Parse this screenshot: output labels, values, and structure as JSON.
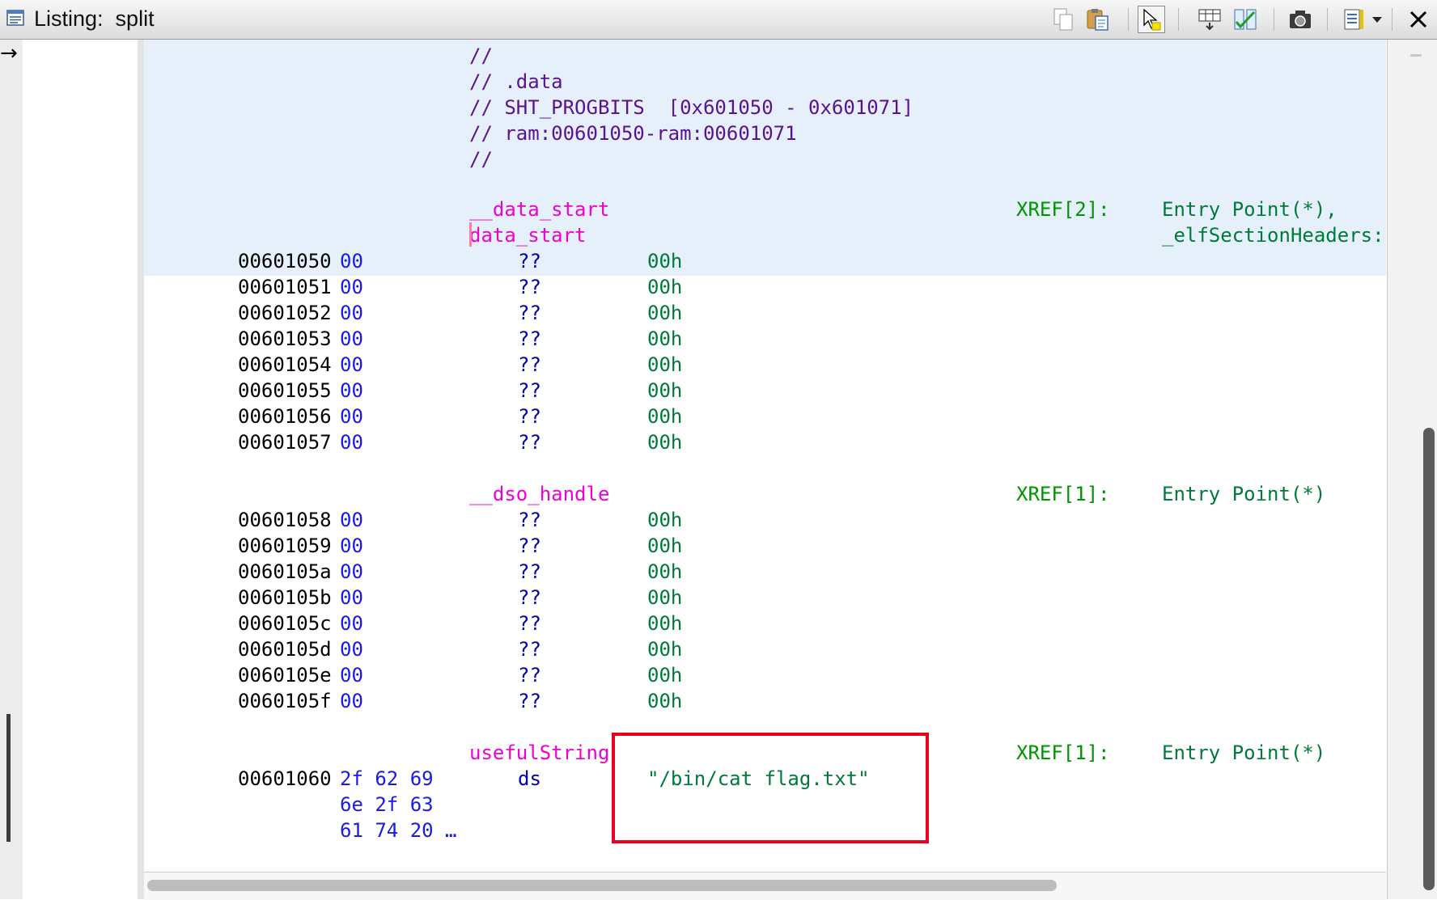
{
  "window": {
    "title": "Listing:  split"
  },
  "toolbar": {
    "icons": [
      "copy-icon",
      "paste-icon",
      "cursor-select-icon",
      "field-editor-icon",
      "diff-icon",
      "snapshot-icon",
      "listing-options-icon",
      "dropdown-arrow-icon",
      "close-icon"
    ]
  },
  "margin": {
    "arrow": "→"
  },
  "listing": {
    "comments": [
      "//",
      "// .data",
      "// SHT_PROGBITS  [0x601050 - 0x601071]",
      "// ram:00601050-ram:00601071",
      "//"
    ],
    "data_start": {
      "labels": [
        "__data_start",
        "data_start"
      ],
      "xref": "XREF[2]:",
      "refs": [
        "Entry Point(*),",
        "_elfSectionHeaders::"
      ]
    },
    "rows_a": [
      {
        "addr": "00601050",
        "byte": "00",
        "mnem": "??",
        "op": "00h"
      },
      {
        "addr": "00601051",
        "byte": "00",
        "mnem": "??",
        "op": "00h"
      },
      {
        "addr": "00601052",
        "byte": "00",
        "mnem": "??",
        "op": "00h"
      },
      {
        "addr": "00601053",
        "byte": "00",
        "mnem": "??",
        "op": "00h"
      },
      {
        "addr": "00601054",
        "byte": "00",
        "mnem": "??",
        "op": "00h"
      },
      {
        "addr": "00601055",
        "byte": "00",
        "mnem": "??",
        "op": "00h"
      },
      {
        "addr": "00601056",
        "byte": "00",
        "mnem": "??",
        "op": "00h"
      },
      {
        "addr": "00601057",
        "byte": "00",
        "mnem": "??",
        "op": "00h"
      }
    ],
    "dso": {
      "label": "__dso_handle",
      "xref": "XREF[1]:",
      "ref": "Entry Point(*)"
    },
    "rows_b": [
      {
        "addr": "00601058",
        "byte": "00",
        "mnem": "??",
        "op": "00h"
      },
      {
        "addr": "00601059",
        "byte": "00",
        "mnem": "??",
        "op": "00h"
      },
      {
        "addr": "0060105a",
        "byte": "00",
        "mnem": "??",
        "op": "00h"
      },
      {
        "addr": "0060105b",
        "byte": "00",
        "mnem": "??",
        "op": "00h"
      },
      {
        "addr": "0060105c",
        "byte": "00",
        "mnem": "??",
        "op": "00h"
      },
      {
        "addr": "0060105d",
        "byte": "00",
        "mnem": "??",
        "op": "00h"
      },
      {
        "addr": "0060105e",
        "byte": "00",
        "mnem": "??",
        "op": "00h"
      },
      {
        "addr": "0060105f",
        "byte": "00",
        "mnem": "??",
        "op": "00h"
      }
    ],
    "useful": {
      "label": "usefulString",
      "xref": "XREF[1]:",
      "ref": "Entry Point(*)",
      "addr": "00601060",
      "bytes": [
        "2f 62 69",
        "6e 2f 63",
        "61 74 20 …"
      ],
      "mnem": "ds",
      "op": "\"/bin/cat flag.txt\""
    }
  },
  "colors": {
    "highlight_band": "#e6f0fb",
    "label": "#ee00d3",
    "comment": "#5a1390",
    "bytes": "#1a1ae8",
    "operand": "#007a3a",
    "xref": "#009300",
    "annotation_box": "#e8001e"
  }
}
